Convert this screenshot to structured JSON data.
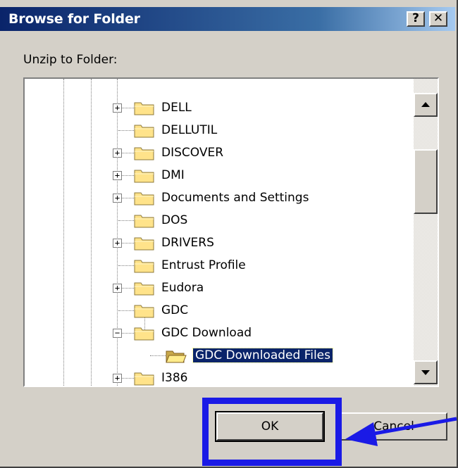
{
  "dialog": {
    "title": "Browse for Folder",
    "help_glyph": "?",
    "close_glyph": "✕",
    "prompt": "Unzip to Folder:",
    "ok_label": "OK",
    "cancel_label": "Cancel"
  },
  "tree": {
    "items": [
      {
        "label": "DELL",
        "expander": "+"
      },
      {
        "label": "DELLUTIL",
        "expander": ""
      },
      {
        "label": "DISCOVER",
        "expander": "+"
      },
      {
        "label": "DMI",
        "expander": "+"
      },
      {
        "label": "Documents and Settings",
        "expander": "+"
      },
      {
        "label": "DOS",
        "expander": ""
      },
      {
        "label": "DRIVERS",
        "expander": "+"
      },
      {
        "label": "Entrust Profile",
        "expander": ""
      },
      {
        "label": "Eudora",
        "expander": "+"
      },
      {
        "label": "GDC",
        "expander": ""
      },
      {
        "label": "GDC Download",
        "expander": "−"
      },
      {
        "label": "GDC Downloaded Files",
        "expander": "",
        "child": true,
        "selected": true,
        "open": true
      },
      {
        "label": "I386",
        "expander": "+"
      }
    ]
  },
  "colors": {
    "title_bar": "#0a246a",
    "selection": "#0a246a",
    "annotation": "#1a1ae6"
  },
  "icons": {
    "folder": "folder-icon",
    "open_folder": "open-folder-icon",
    "scroll_up": "scroll-up-arrow-icon",
    "scroll_down": "scroll-down-arrow-icon",
    "pointer_arrow": "annotation-arrow-icon"
  }
}
